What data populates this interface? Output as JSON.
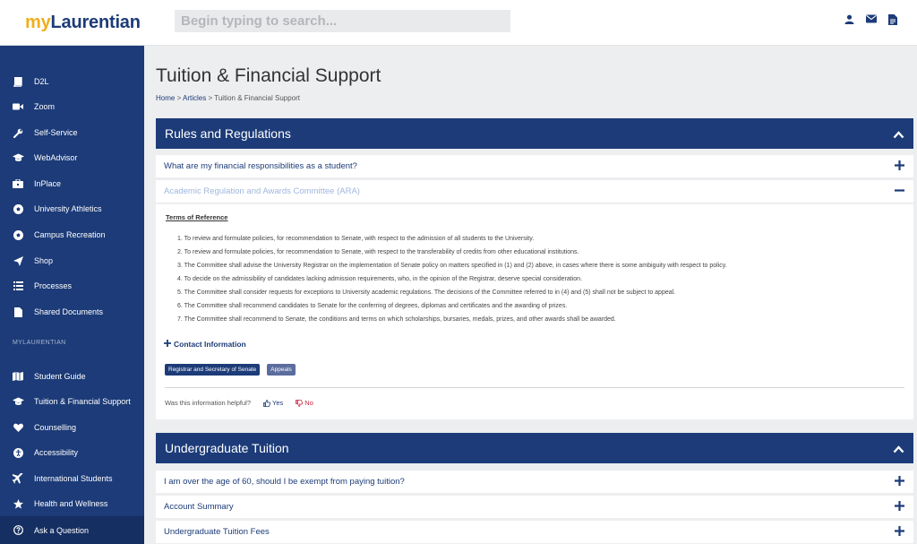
{
  "logo": {
    "my": "my",
    "rest": "Laurentian"
  },
  "search": {
    "placeholder": "Begin typing to search..."
  },
  "top_icons": [
    "user-icon",
    "envelope-icon",
    "document-icon"
  ],
  "sidebar": {
    "items": [
      {
        "label": "D2L",
        "icon": "book-icon"
      },
      {
        "label": "Zoom",
        "icon": "video-camera-icon"
      },
      {
        "label": "Self-Service",
        "icon": "wrench-icon"
      },
      {
        "label": "WebAdvisor",
        "icon": "graduation-cap-icon"
      },
      {
        "label": "InPlace",
        "icon": "briefcase-icon"
      },
      {
        "label": "University Athletics",
        "icon": "soccer-ball-icon"
      },
      {
        "label": "Campus Recreation",
        "icon": "soccer-ball-icon"
      },
      {
        "label": "Shop",
        "icon": "paper-plane-icon"
      },
      {
        "label": "Processes",
        "icon": "list-icon"
      },
      {
        "label": "Shared Documents",
        "icon": "file-icon"
      }
    ],
    "section_label": "MYLAURENTIAN",
    "section_items": [
      {
        "label": "Student Guide",
        "icon": "map-icon"
      },
      {
        "label": "Tuition & Financial Support",
        "icon": "graduation-cap-icon"
      },
      {
        "label": "Counselling",
        "icon": "heart-icon"
      },
      {
        "label": "Accessibility",
        "icon": "accessibility-icon"
      },
      {
        "label": "International Students",
        "icon": "plane-icon"
      },
      {
        "label": "Health and Wellness",
        "icon": "star-icon"
      }
    ],
    "bottom_item": {
      "label": "Ask a Question",
      "icon": "question-circle-icon"
    }
  },
  "page": {
    "title": "Tuition & Financial Support",
    "breadcrumb": {
      "home": "Home",
      "sep1": " > ",
      "articles": "Articles",
      "sep2": " > ",
      "current": "Tuition & Financial Support"
    }
  },
  "rules_panel": {
    "title": "Rules and Regulations",
    "rows": [
      {
        "label": "What are my financial responsibilities as a student?",
        "state": "collapsed"
      },
      {
        "label": "Academic Regulation and Awards Committee (ARA)",
        "state": "expanded"
      }
    ],
    "expanded": {
      "heading": "Terms of Reference",
      "items": [
        "1. To review and formulate policies, for recommendation to Senate, with respect to the admission of all students to the University.",
        "2. To review and formulate policies, for recommendation to Senate, with respect to the transferability of credits from other educational institutions.",
        "3. The Committee shall advise the University Registrar on the implementation of Senate policy on matters specified in (1) and (2) above, in cases where there is some ambiguity with respect to policy.",
        "4. To decide on the admissibility of candidates lacking admission requirements, who, in the opinion of the Registrar, deserve special consideration.",
        "5. The Committee shall consider requests for exceptions to University academic regulations. The decisions of the Committee referred to in (4) and (5) shall not be subject to appeal.",
        "6. The Committee shall recommend candidates to Senate for the conferring of degrees, diplomas and certificates and the awarding of prizes.",
        "7. The Committee shall recommend to Senate, the conditions and terms on which scholarships, bursaries, medals, prizes, and other awards shall be awarded."
      ],
      "contact_label": "Contact Information",
      "tags": [
        "Registrar and Secretary of Senate",
        "Appeals"
      ],
      "helpful_question": "Was this information helpful?",
      "yes_label": "Yes",
      "no_label": "No"
    }
  },
  "tuition_panel": {
    "title": "Undergraduate Tuition",
    "rows": [
      {
        "label": "I am over the age of 60, should I be exempt from paying tuition?"
      },
      {
        "label": "Account Summary"
      },
      {
        "label": "Undergraduate Tuition Fees"
      }
    ]
  },
  "colors": {
    "brand_navy": "#1c3b78",
    "brand_gold": "#f0ae1d",
    "no_red": "#c6263f"
  }
}
